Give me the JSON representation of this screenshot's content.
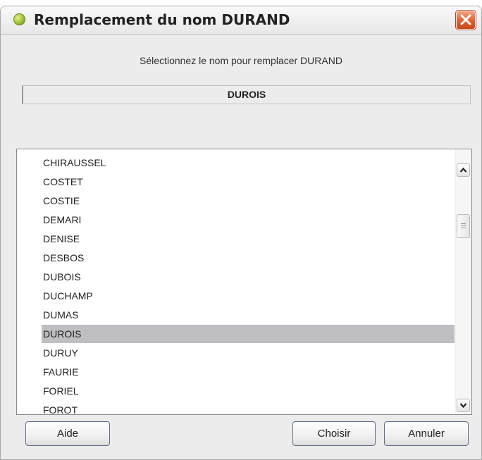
{
  "window": {
    "title": "Remplacement du nom DURAND"
  },
  "prompt": "Sélectionnez le nom pour remplacer DURAND",
  "selected_name": "DUROIS",
  "list": {
    "items": [
      "CHIRAUSSEL",
      "COSTET",
      "COSTIE",
      "DEMARI",
      "DENISE",
      "DESBOS",
      "DUBOIS",
      "DUCHAMP",
      "DUMAS",
      "DUROIS",
      "DURUY",
      "FAURIE",
      "FORIEL",
      "FOROT"
    ],
    "selected_index": 9
  },
  "buttons": {
    "help": "Aide",
    "choose": "Choisir",
    "cancel": "Annuler"
  },
  "icons": {
    "app": "leaf-icon",
    "close": "close-icon",
    "scroll_up": "chevron-up-icon",
    "scroll_down": "chevron-down-icon"
  },
  "colors": {
    "selection": "#bfbec3",
    "close_button": "#e0602f"
  }
}
